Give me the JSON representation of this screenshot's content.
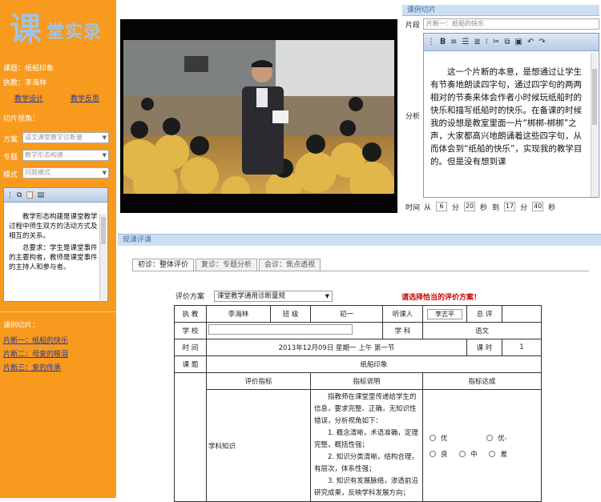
{
  "logo": {
    "char": "课",
    "text": "堂实录"
  },
  "sidebar": {
    "topic_label": "课题：纸船印象",
    "teacher_label": "执教：李海林",
    "link_design": "教学设计",
    "link_reflect": "教学反思",
    "perspective_label": "切片视角：",
    "fields": [
      {
        "label": "方案",
        "value": "语文课堂教学诊断量"
      },
      {
        "label": "专题",
        "value": "教学形态构建"
      },
      {
        "label": "模式",
        "value": "问题模式"
      }
    ],
    "editor_text": [
      "教学形态构建是课堂教学过程中师生双方的活动方式及相互的关系。",
      "总要求：学生是课堂事件的主要构者，教师是课堂事件的主持人和参与者。"
    ],
    "clips_heading": "课例切片：",
    "clips": [
      "片断一：纸船的快乐",
      "片断二：母爱的眼泪",
      "片断三：爱的传承"
    ]
  },
  "clip_panel": {
    "title": "课例切片",
    "segment_label": "片段",
    "segment_value": "片断一：纸船的快乐",
    "analysis_label": "分析",
    "analysis_text": "这一个片断的本意，是想通过让学生有节奏地朗读四字句，通过四字句的两两相对的节奏来体会作者小时候玩纸船时的快乐和描写纸船时的快乐。在备课的时候我的设想是教室里面一片“梆梆-梆梆”之声，大家都高兴地朗诵着这些四字句，从而体会到“纸船的快乐”，实现我的教学目的。但是没有想到课",
    "time": {
      "label": "时间",
      "from": "从",
      "start_min": "6",
      "min": "分",
      "start_sec": "20",
      "sec": "秒",
      "to": "到",
      "end_min": "17",
      "end_sec": "40"
    }
  },
  "review": {
    "title": "观课评课",
    "tabs": [
      "初诊：整体评价",
      "复诊：专题分析",
      "会诊：焦点透视"
    ],
    "scheme_label": "评价方案",
    "scheme_value": "课堂教学通用诊断量规",
    "scheme_warning": "请选择恰当的评价方案！",
    "rows": {
      "teacher_l": "执  教",
      "teacher_v": "李海林",
      "grade_l": "班  级",
      "grade_v": "初一",
      "listener_l": "听课人",
      "listener_v": "李志平",
      "total_l": "总  评",
      "school_l": "学  校",
      "subject_l": "学  科",
      "subject_v": "语文",
      "time_l": "时  间",
      "time_v": "2013年12月09日 星期一 上午 第一节",
      "hours_l": "课  时",
      "hours_v": "1",
      "topic_l": "课  题",
      "topic_v": "纸船印象"
    },
    "headers": [
      "评价指标",
      "指标说明",
      "指标达成"
    ],
    "indicator": "学科知识",
    "desc_intro": "指教师在课堂里传递给学生的信息，要求完整、正确，无知识性错误，分析视角如下：",
    "desc_items": [
      "1. 概念清晰，术语准确，定理完整，概括性强；",
      "2. 知识分类清晰，结构合理，有层次，体系性强；",
      "3. 知识有发展脉络，渗透前沿研究成果，反映学科发展方向；"
    ],
    "options": [
      "优",
      "优-",
      "良",
      "中",
      "差"
    ]
  }
}
